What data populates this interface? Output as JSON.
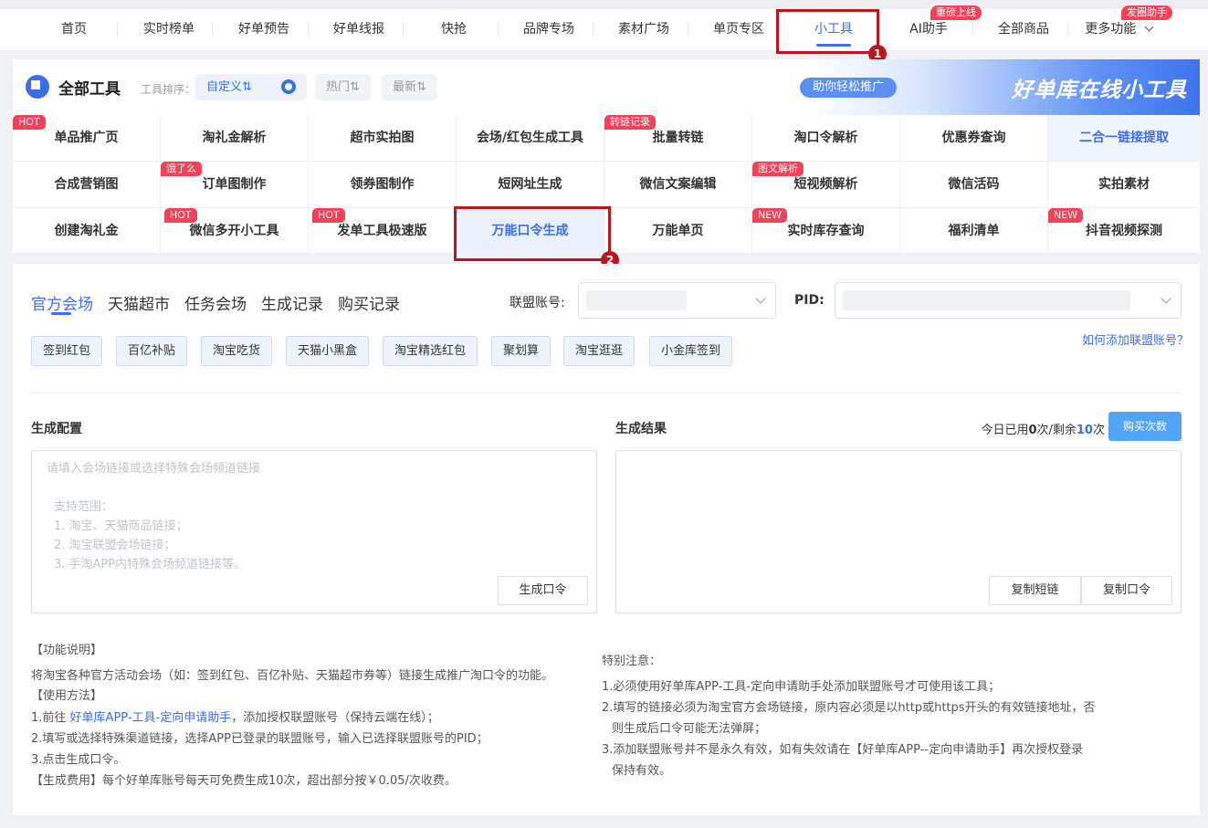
{
  "nav": {
    "items": [
      "首页",
      "实时榜单",
      "好单预告",
      "好单线报",
      "快抢",
      "品牌专场",
      "素材广场",
      "单页专区",
      "小工具",
      "AI助手",
      "全部商品",
      "更多功能"
    ],
    "active": "小工具",
    "badges": {
      "ai": "重磅上线",
      "more": "发圈助手"
    },
    "annotation_1": "1"
  },
  "tools": {
    "title": "全部工具",
    "sort_label": "工具排序：",
    "sort_custom": "自定义⇅",
    "sort_hot": "热门⇅",
    "sort_new": "最新⇅",
    "banner_slogan": "助你轻松推广",
    "banner_title": "好单库在线小工具",
    "rows": [
      [
        "单品推广页",
        "淘礼金解析",
        "超市实拍图",
        "会场/红包生成工具",
        "批量转链",
        "淘口令解析",
        "优惠券查询",
        "二合一链接提取"
      ],
      [
        "合成营销图",
        "订单图制作",
        "领券图制作",
        "短网址生成",
        "微信文案编辑",
        "短视频解析",
        "微信活码",
        "实拍素材"
      ],
      [
        "创建淘礼金",
        "微信多开小工具",
        "发单工具极速版",
        "万能口令生成",
        "万能单页",
        "实时库存查询",
        "福利清单",
        "抖音视频探测"
      ]
    ],
    "badges": {
      "hot": "HOT",
      "zhuanlian": "转链记录",
      "eleme": "饿了么",
      "tuwen": "图文解析",
      "new": "NEW"
    },
    "annotation_2": "2"
  },
  "main": {
    "tabs": [
      "官方会场",
      "天猫超市",
      "任务会场",
      "生成记录",
      "购买记录"
    ],
    "alliance_label": "联盟账号:",
    "pid_label": "PID:",
    "help_link": "如何添加联盟账号？",
    "chips": [
      "签到红包",
      "百亿补贴",
      "淘宝吃货",
      "天猫小黑盒",
      "淘宝精选红包",
      "聚划算",
      "淘宝逛逛",
      "小金库签到"
    ],
    "config_title": "生成配置",
    "result_title": "生成结果",
    "usage_prefix": "今日已用",
    "used": "0",
    "usage_mid": "次/剩余",
    "remaining": "10",
    "usage_suffix": "次",
    "buy_button": "购买次数",
    "placeholder": "请填入会场链接或选择特殊会场频道链接",
    "scope_title": "支持范围：",
    "scope_items": [
      "1. 淘宝、天猫商品链接；",
      "2. 淘宝联盟会场链接；",
      "3. 手淘APP内特殊会场频道链接等。"
    ],
    "generate_button": "生成口令",
    "copy_short": "复制短链",
    "copy_code": "复制口令"
  },
  "description": {
    "func_title": "【功能说明】",
    "func_text": "将淘宝各种官方活动会场（如：签到红包、百亿补贴、天猫超市券等）链接生成推广淘口令的功能。",
    "usage_title": "【使用方法】",
    "step1_prefix": "1.前往 ",
    "step1_link": "好单库APP-工具-定向申请助手",
    "step1_suffix": "，添加授权联盟账号（保持云端在线）；",
    "step2": "2.填写或选择特殊渠道链接，选择APP已登录的联盟账号，输入已选择联盟账号的PID；",
    "step3": "3.点击生成口令。",
    "fee": "【生成费用】每个好单库账号每天可免费生成10次，超出部分按￥0.05/次收费。",
    "notice_title": "特别注意：",
    "notice1": "1.必须使用好单库APP-工具-定向申请助手处添加联盟账号才可使用该工具；",
    "notice2a": "2.填写的链接必须为淘宝官方会场链接，原内容必须是以http或https开头的有效链接地址，否",
    "notice2b": "则生成后口令可能无法弹屏；",
    "notice3a": "3.添加联盟账号并不是永久有效，如有失效请在【好单库APP--定向申请助手】再次授权登录",
    "notice3b": "保持有效。"
  }
}
